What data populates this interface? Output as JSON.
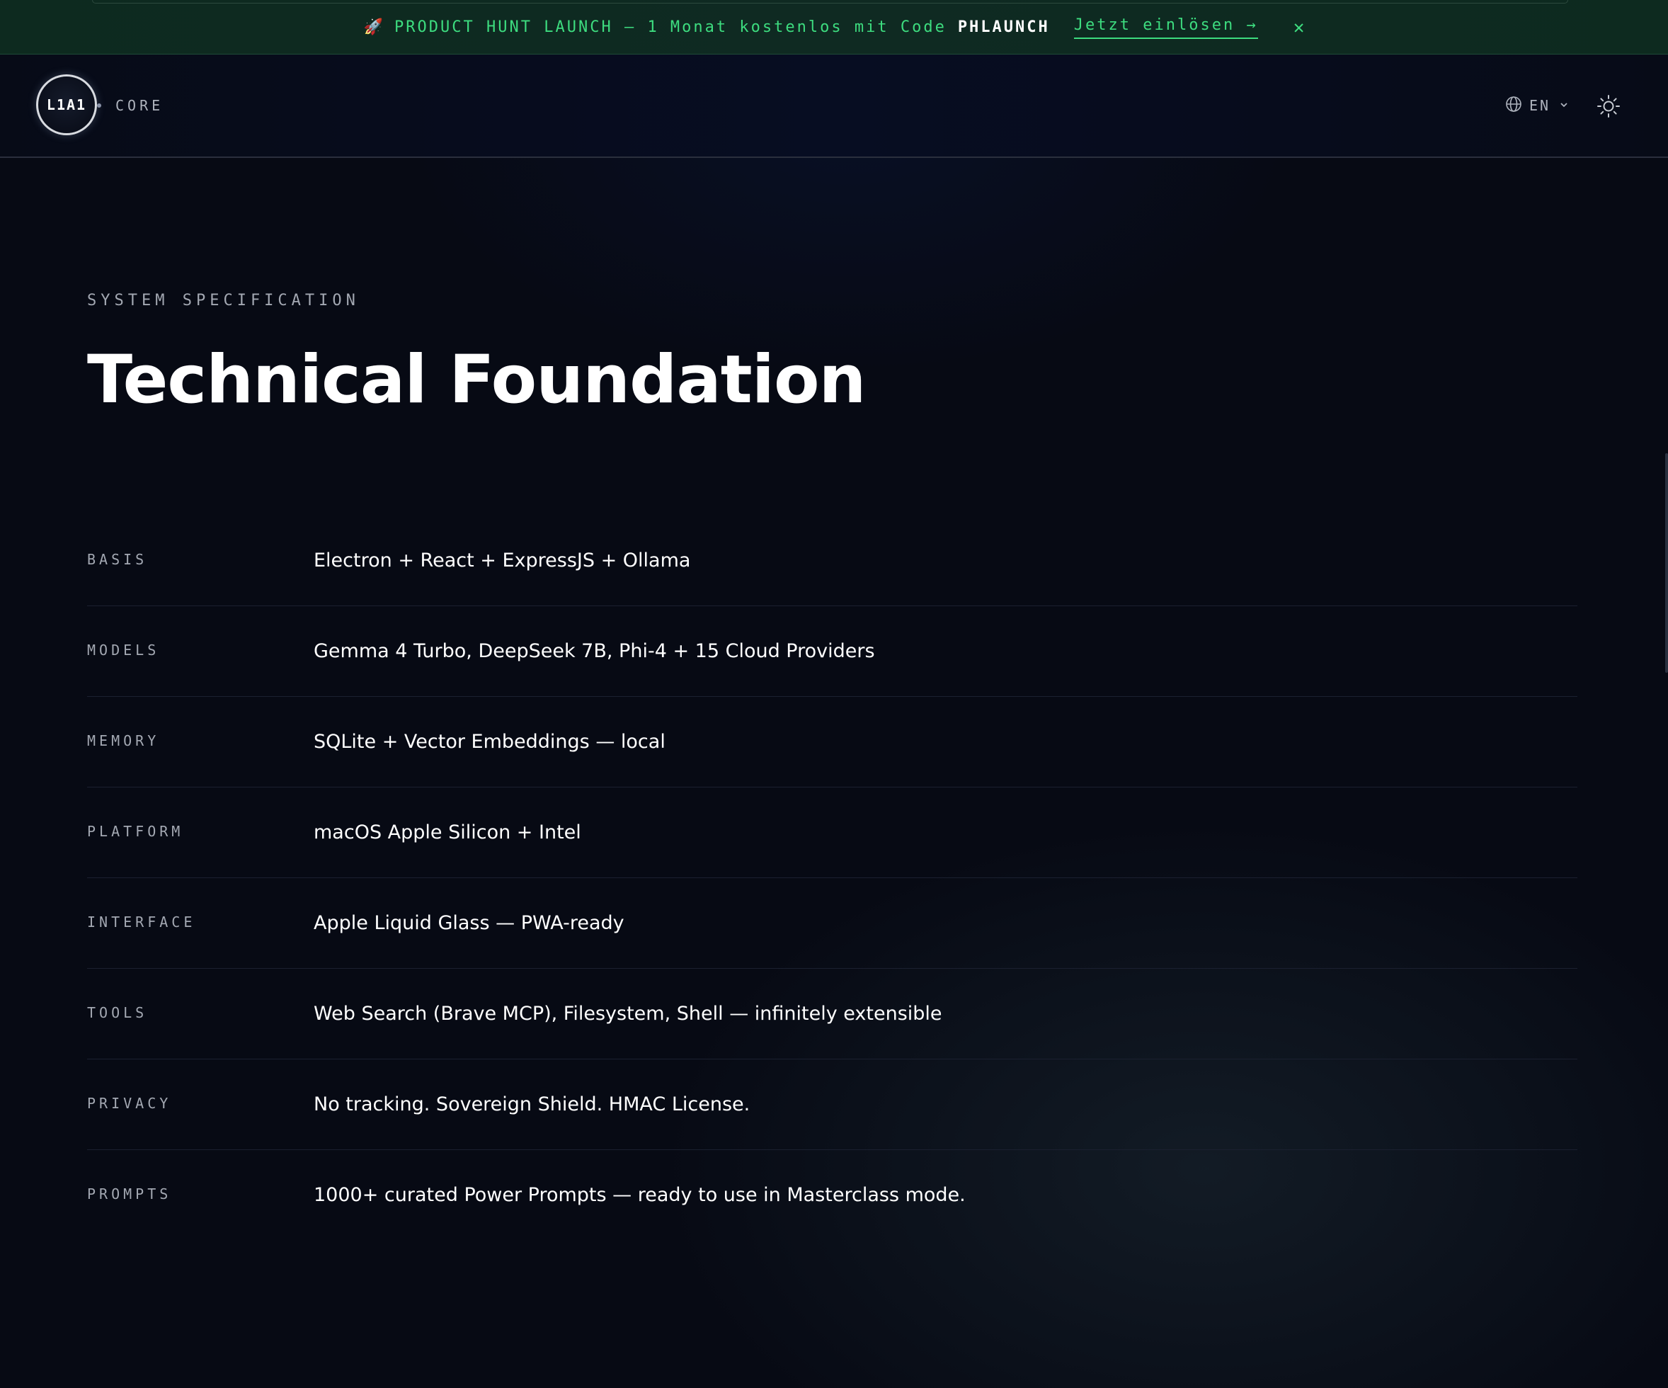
{
  "promo": {
    "rocket_icon": "rocket-icon",
    "text": "PRODUCT HUNT LAUNCH — 1 Monat kostenlos mit Code",
    "code": "PHLAUNCH",
    "link_label": "Jetzt einlösen →",
    "close_label": "✕",
    "accent": "#3ddc7f"
  },
  "header": {
    "logo_text": "L1A1",
    "brand_sub": "CORE",
    "language": "EN",
    "globe_icon": "globe-icon",
    "chevron_icon": "chevron-down-icon",
    "theme_icon": "sun-icon"
  },
  "main": {
    "eyebrow": "SYSTEM SPECIFICATION",
    "title": "Technical Foundation",
    "specs": [
      {
        "key": "BASIS",
        "value": "Electron + React + ExpressJS + Ollama"
      },
      {
        "key": "MODELS",
        "value": "Gemma 4 Turbo, DeepSeek 7B, Phi-4 + 15 Cloud Providers"
      },
      {
        "key": "MEMORY",
        "value": "SQLite + Vector Embeddings — local"
      },
      {
        "key": "PLATFORM",
        "value": "macOS Apple Silicon + Intel"
      },
      {
        "key": "INTERFACE",
        "value": "Apple Liquid Glass — PWA-ready"
      },
      {
        "key": "TOOLS",
        "value": "Web Search (Brave MCP), Filesystem, Shell — infinitely extensible"
      },
      {
        "key": "PRIVACY",
        "value": "No tracking. Sovereign Shield. HMAC License."
      },
      {
        "key": "PROMPTS",
        "value": "1000+ curated Power Prompts — ready to use in Masterclass mode."
      }
    ]
  }
}
